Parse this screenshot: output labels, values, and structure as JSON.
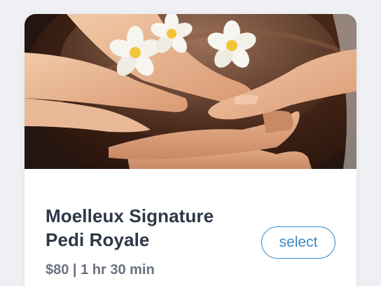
{
  "service": {
    "title_line1": "Moelleux Signature",
    "title_line2": "Pedi Royale",
    "price": "$80",
    "separator": "|",
    "duration": "1 hr 30 min",
    "meta": "$80 | 1 hr 30 min",
    "select_label": "select"
  },
  "colors": {
    "accent": "#3c8bc8",
    "title": "#2e3746",
    "meta": "#6b7280",
    "background": "#eef0f3"
  }
}
